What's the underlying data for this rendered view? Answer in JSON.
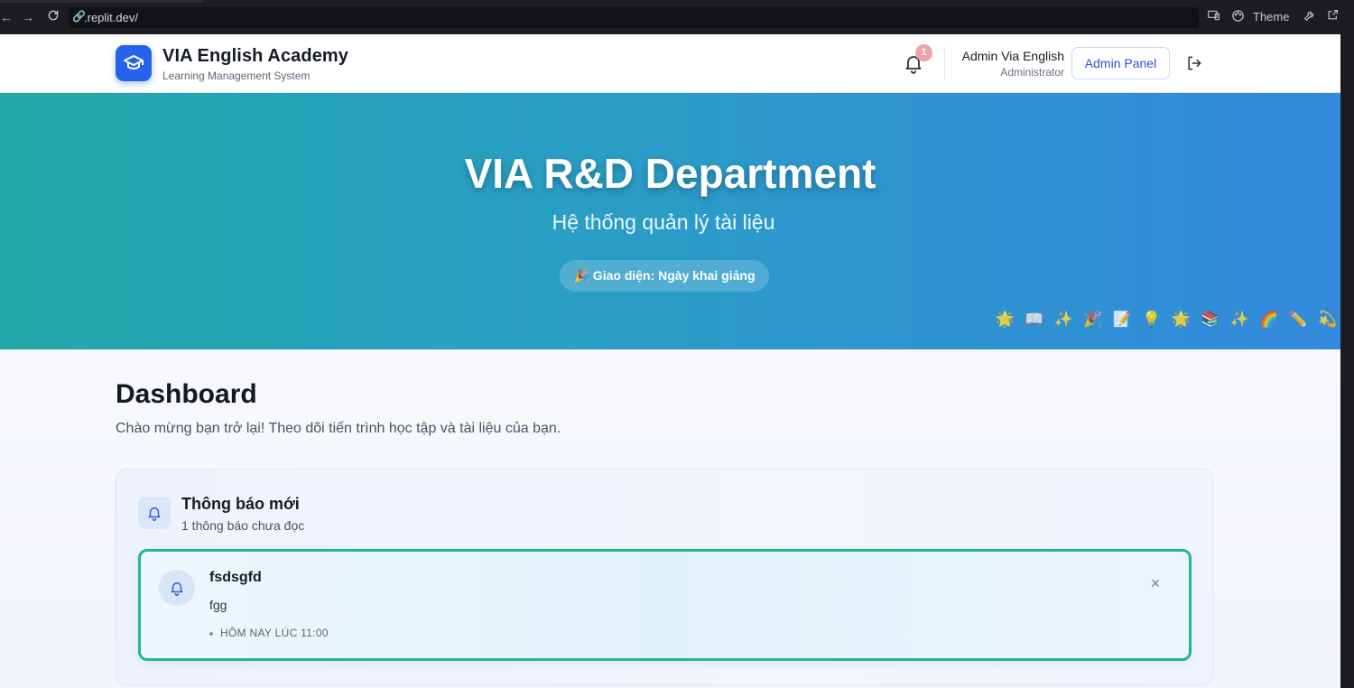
{
  "browser": {
    "url": ".replit.dev/",
    "theme_label": "Theme",
    "back_icon": "arrow-left-icon",
    "forward_icon": "arrow-right-icon",
    "reload_icon": "reload-icon"
  },
  "header": {
    "brand_title": "VIA English Academy",
    "brand_subtitle": "Learning Management System",
    "notification_count": "1",
    "user_name": "Admin Via English",
    "user_role": "Administrator",
    "admin_button": "Admin Panel",
    "accent_color": "#2563eb"
  },
  "hero": {
    "title": "VIA R&D Department",
    "subtitle": "Hệ thống quản lý tài liệu",
    "theme_badge": "🎉 Giao diện: Ngày khai giảng",
    "decorations": [
      "🌟",
      "📖",
      "✨",
      "🎉",
      "📝",
      "💡",
      "🌟",
      "📚",
      "✨",
      "🌈",
      "✏️",
      "💫"
    ]
  },
  "dashboard": {
    "title": "Dashboard",
    "subtitle": "Chào mừng bạn trở lại! Theo dõi tiến trình học tập và tài liệu của bạn."
  },
  "notifications": {
    "title": "Thông báo mới",
    "unread_text": "1 thông báo chưa đọc",
    "items": [
      {
        "title": "fsdsgfd",
        "body": "fgg",
        "time": "HÔM NAY LÚC 11:00",
        "highlight_color": "#21b98a"
      }
    ]
  }
}
